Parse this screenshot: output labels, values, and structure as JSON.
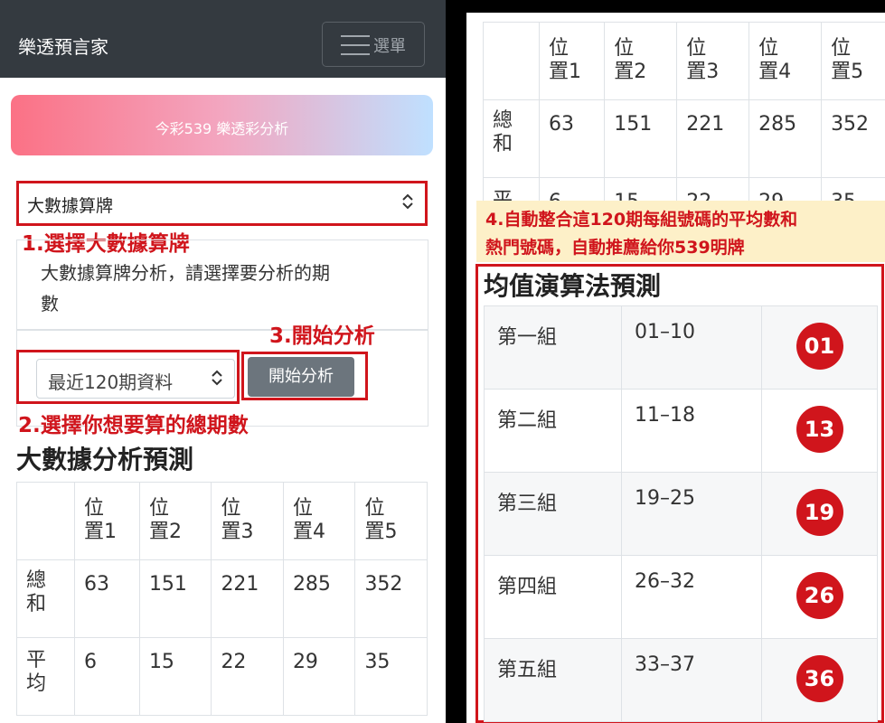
{
  "nav": {
    "brand": "樂透預言家",
    "menu_label": "選單"
  },
  "banner": {
    "text": "今彩539 樂透彩分析"
  },
  "method_select": {
    "value": "大數據算牌"
  },
  "annotations": {
    "step1": "1.選擇大數據算牌",
    "step2": "2.選擇你想要算的總期數",
    "step3": "3.開始分析",
    "step4_line1": "4.自動整合這120期每組號碼的平均數和",
    "step4_line2": "熱門號碼，自動推薦給你539明牌"
  },
  "intro_text": {
    "line1": "大數據算牌分析，請選擇要分析的期",
    "line2": "數"
  },
  "period_select": {
    "value": "最近120期資料"
  },
  "start_button": {
    "label": "開始分析"
  },
  "analysis": {
    "title": "大數據分析預測",
    "headers": [
      {
        "a": "位",
        "b": "置1"
      },
      {
        "a": "位",
        "b": "置2"
      },
      {
        "a": "位",
        "b": "置3"
      },
      {
        "a": "位",
        "b": "置4"
      },
      {
        "a": "位",
        "b": "置5"
      }
    ],
    "rows": [
      {
        "label_a": "總",
        "label_b": "和",
        "values": [
          "63",
          "151",
          "221",
          "285",
          "352"
        ]
      },
      {
        "label_a": "平",
        "label_b": "均",
        "values": [
          "6",
          "15",
          "22",
          "29",
          "35"
        ]
      }
    ]
  },
  "prediction": {
    "title": "均值演算法預測",
    "groups": [
      {
        "name": "第一組",
        "range": "01–10",
        "pick": "01"
      },
      {
        "name": "第二組",
        "range": "11–18",
        "pick": "13"
      },
      {
        "name": "第三組",
        "range": "19–25",
        "pick": "19"
      },
      {
        "name": "第四組",
        "range": "26–32",
        "pick": "26"
      },
      {
        "name": "第五組",
        "range": "33–37",
        "pick": "36"
      }
    ]
  },
  "colors": {
    "accent_red": "#d0151c",
    "navbar": "#343a40",
    "button_gray": "#6c757d"
  }
}
